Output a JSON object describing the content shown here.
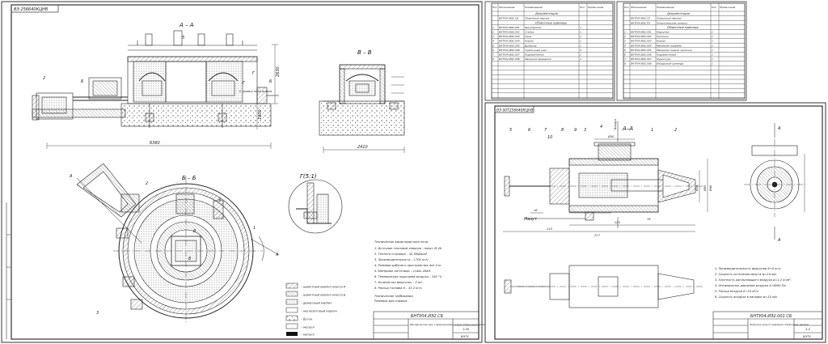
{
  "sheet1": {
    "corner_stamp": "ВЭ 256640КЦНВ",
    "views": {
      "aa": "А – А",
      "bb": "Б – Б",
      "vv": "В – В",
      "detail": "Г(5:1)"
    },
    "section_letters": [
      "А",
      "А",
      "Б",
      "Б",
      "В",
      "В",
      "Г",
      "Г"
    ],
    "callouts": [
      "1",
      "2",
      "3",
      "4",
      "5",
      "6",
      "7",
      "8"
    ],
    "dims": {
      "total_width": "6360",
      "height": "2630",
      "vv_width": "2410",
      "level": "1800",
      "note": "У уровня пола шлака"
    },
    "legend": [
      "– шамотный кирпич класса А",
      "– шамотный кирпич класса Б",
      "– динасовый кирпич",
      "– магнезитовый кирпич",
      "– бетон",
      "– металл",
      "– металл"
    ],
    "spec_title": "Техническая характеристика печи",
    "spec_lines": [
      "1. Источник тепловой энергии – мазут М 40.",
      "2. Теплота сгорания – 42,5МДж/м³.",
      "3. Производительность – 1700 кг/ч.",
      "4. Размеры рабочего пространства 4х2,0 м.",
      "5. Материал заготовки – сталь 40ХН.",
      "6. Температура подогрева воздуха – 340 °С.",
      "7. Количество форсунок – 3 шт.",
      "8. Расход топлива 8 – 43,2 кг/ч."
    ],
    "req_title": "Технические требования",
    "req_lines": [
      "Размеры для справок"
    ],
    "title_block": {
      "code": "БНТУ04.ИЭ2.СБ",
      "name": "Методическая печь с вращающимся подом (Сборочный чертеж)",
      "scale": "1:20",
      "org": "БНТУ"
    }
  },
  "spec_sheets": [
    {
      "header": [
        "Поз.",
        "Обозначение",
        "Наименование",
        "Кол.",
        "Приме-чание"
      ],
      "sections": [
        {
          "title": "Документация",
          "rows": [
            [
              "",
              "БНТУ04.ИЭ2.СБ",
              "Сборочный чертеж",
              "",
              ""
            ]
          ]
        },
        {
          "title": "Сборочные единицы",
          "rows": [
            [
              "1",
              "БНТУ04.ИЭ2.001",
              "Рекуператор",
              "1",
              ""
            ],
            [
              "2",
              "БНТУ04.ИЭ2.002",
              "Стенка",
              "1",
              ""
            ],
            [
              "3",
              "БНТУ04.ИЭ2.003",
              "Свод",
              "1",
              ""
            ],
            [
              "4",
              "БНТУ04.ИЭ2.004",
              "Корпус",
              "1",
              ""
            ],
            [
              "5",
              "БНТУ04.ИЭ2.005",
              "Дымоход",
              "1",
              ""
            ],
            [
              "6",
              "БНТУ04.ИЭ2.006",
              "Горелочный узел",
              "3",
              ""
            ],
            [
              "7",
              "БНТУ04.ИЭ2.007",
              "Подовая балка",
              "1",
              ""
            ],
            [
              "8",
              "БНТУ04.ИЭ2.008",
              "Механизм вращения",
              "1",
              ""
            ]
          ]
        }
      ]
    },
    {
      "header": [
        "Поз.",
        "Обозначение",
        "Наименование",
        "Кол.",
        "Приме-чание"
      ],
      "sections": [
        {
          "title": "Документация",
          "rows": [
            [
              "",
              "БНТУ04.ИЭ2.С5",
              "Сборочный чертеж",
              "",
              ""
            ],
            [
              "",
              "БНТУ04.ИЭ2.ПЗ",
              "Пояснительная записка",
              "",
              ""
            ]
          ]
        },
        {
          "title": "Сборочные единицы",
          "rows": [
            [
              "1",
              "БНТУ04.ИЭ2.001",
              "Форсунка",
              "1",
              ""
            ],
            [
              "2",
              "БНТУ04.ИЭ2.002",
              "Заслонка",
              "1",
              ""
            ],
            [
              "3",
              "БНТУ04.ИЭ2.003",
              "Корпус",
              "1",
              ""
            ],
            [
              "4",
              "БНТУ04.ИЭ2.004",
              "Механизм подъема",
              "1",
              ""
            ],
            [
              "5",
              "БНТУ04.ИЭ2.005",
              "Механизм подачи заслонки",
              "1",
              ""
            ],
            [
              "6",
              "БНТУ04.ИЭ2.006",
              "Подовая опора",
              "1",
              ""
            ],
            [
              "7",
              "БНТУ04.ИЭ2.007",
              "Фурнитура",
              "1",
              ""
            ],
            [
              "8",
              "БНТУ04.ИЭ2.008",
              "Воздушный цилиндр",
              "1",
              ""
            ]
          ]
        }
      ]
    }
  ],
  "sheet4": {
    "corner_stamp": "ВЭ 00Т256640КЦНВ",
    "view": "А–А",
    "arrow_letters": [
      "А",
      "А"
    ],
    "callouts": [
      "1",
      "2",
      "3",
      "4",
      "5",
      "6",
      "7",
      "8",
      "9",
      "10"
    ],
    "labels": {
      "air": "Воздух",
      "fuel": "Мазут"
    },
    "dims": [
      "Ø50",
      "Ø28",
      "125",
      "16",
      "78",
      "115",
      "217",
      "Ø65",
      "Ø40"
    ],
    "spec_lines": [
      "1. Производительность форсунки 6÷8 кг/ч.",
      "2. Скорость истечения мазута w=10 м/с.",
      "3. Плотность распыляющего воздуха ρ=1,2 кг/м³.",
      "4. Оптимальное давление воздуха 4÷6000 Па.",
      "5. Расход воздуха 8÷10 м³/ч.",
      "6. Скорость воздуха в насадке w=15 м/с."
    ],
    "title_block": {
      "code": "БНТУ04.ИЭ2.001 СБ",
      "name": "Форсунка низкого давления (Сборочный чертеж)",
      "scale": "1:2",
      "org": "БНТУ"
    }
  }
}
